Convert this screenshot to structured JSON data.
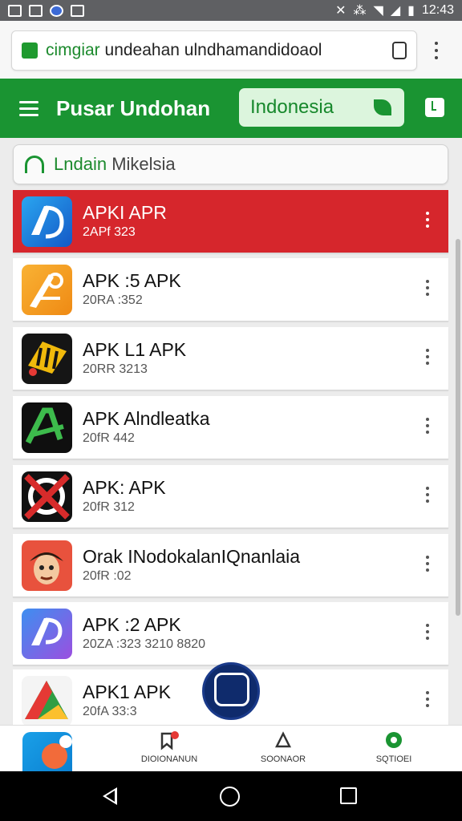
{
  "status_bar": {
    "time": "12:43"
  },
  "browser": {
    "url_green": "cimgiar",
    "url_rest": " undeahan ulndhamandidoaol"
  },
  "toolbar": {
    "title": "Pusar Undohan",
    "country": "Indonesia"
  },
  "search": {
    "icon": "search-icon",
    "green": "Lndain",
    "rest": " Mikelsia"
  },
  "apps": [
    {
      "name": "APKI APR",
      "meta": "2APf 323",
      "highlighted": true,
      "icon_colors": [
        "#1e8fe0",
        "#1561c9"
      ]
    },
    {
      "name": "APK :5 APK",
      "meta": "20RA :352",
      "highlighted": false,
      "icon_colors": [
        "#f7a21a",
        "#f08a12"
      ]
    },
    {
      "name": "APK L1 APK",
      "meta": "20RR 3213",
      "highlighted": false,
      "icon_colors": [
        "#1b1b1b",
        "#f0b90b"
      ]
    },
    {
      "name": "APK Alndleatka",
      "meta": "20fR 442",
      "highlighted": false,
      "icon_colors": [
        "#111",
        "#38b44a"
      ]
    },
    {
      "name": "APK: APK",
      "meta": "20fR 312",
      "highlighted": false,
      "icon_colors": [
        "#141414",
        "#d72b2b"
      ]
    },
    {
      "name": "Orak INodokalanIQnanlaia",
      "meta": "20fR :02",
      "highlighted": false,
      "icon_colors": [
        "#e8523d",
        "#5a2a12"
      ]
    },
    {
      "name": "APK :2 APK",
      "meta": "20ZA :323 3210 8820",
      "highlighted": false,
      "icon_colors": [
        "#3d7fe6",
        "#9b4fe0"
      ]
    },
    {
      "name": "APK1 APK",
      "meta": "20fA 33:3",
      "highlighted": false,
      "icon_colors": [
        "#2f9e44",
        "#e53935"
      ]
    }
  ],
  "bottom_nav": [
    {
      "label": "",
      "icon": "app-icon"
    },
    {
      "label": "DIOIONANUN",
      "icon": "bookmark-badge-icon"
    },
    {
      "label": "SOONAOR",
      "icon": "bell-icon"
    },
    {
      "label": "SQTIOEI",
      "icon": "chat-icon"
    }
  ],
  "colors": {
    "brand": "#1a9432",
    "highlight": "#d6262c"
  }
}
